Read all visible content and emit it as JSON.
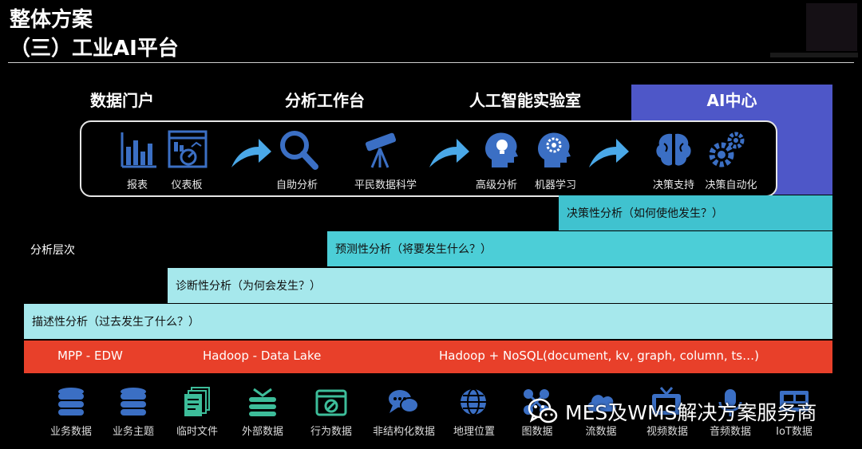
{
  "header": {
    "title_line1": "整体方案",
    "title_line2": "（三）工业AI平台"
  },
  "categories": [
    {
      "label": "数据门户"
    },
    {
      "label": "分析工作台"
    },
    {
      "label": "人工智能实验室"
    },
    {
      "label": "AI中心"
    }
  ],
  "tools": [
    {
      "label": "报表",
      "icon": "bar-chart-icon"
    },
    {
      "label": "仪表板",
      "icon": "dashboard-icon"
    },
    {
      "label": "自助分析",
      "icon": "magnifier-icon"
    },
    {
      "label": "平民数据科学",
      "icon": "telescope-icon"
    },
    {
      "label": "高级分析",
      "icon": "lightbulb-head-icon"
    },
    {
      "label": "机器学习",
      "icon": "gear-head-icon"
    },
    {
      "label": "决策支持",
      "icon": "brain-icon"
    },
    {
      "label": "决策自动化",
      "icon": "gears-icon"
    }
  ],
  "analysis": {
    "layer_label": "分析层次",
    "levels": [
      {
        "label": "决策性分析（如何使他发生？）"
      },
      {
        "label": "预测性分析（将要发生什么？）"
      },
      {
        "label": "诊断性分析（为何会发生？）"
      },
      {
        "label": "描述性分析（过去发生了什么？）"
      }
    ]
  },
  "storage": [
    {
      "label": "MPP - EDW"
    },
    {
      "label": "Hadoop - Data Lake"
    },
    {
      "label": "Hadoop + NoSQL(document, kv, graph, column, ts…)"
    }
  ],
  "sources": [
    {
      "label": "业务数据",
      "icon": "database-icon"
    },
    {
      "label": "业务主题",
      "icon": "database-icon"
    },
    {
      "label": "临时文件",
      "icon": "files-icon"
    },
    {
      "label": "外部数据",
      "icon": "external-data-icon"
    },
    {
      "label": "行为数据",
      "icon": "behavior-icon"
    },
    {
      "label": "非结构化数据",
      "icon": "chat-bubbles-icon"
    },
    {
      "label": "地理位置",
      "icon": "globe-icon"
    },
    {
      "label": "图数据",
      "icon": "graph-icon"
    },
    {
      "label": "流数据",
      "icon": "cloud-icon"
    },
    {
      "label": "视频数据",
      "icon": "tv-icon"
    },
    {
      "label": "音频数据",
      "icon": "audio-icon"
    },
    {
      "label": "IoT数据",
      "icon": "iot-icon"
    }
  ],
  "watermark": {
    "text": "MES及WMS解决方案服务商"
  },
  "colors": {
    "ai_block": "#4e57c8",
    "decision_band": "#40c2cf",
    "predictive_band": "#4cced7",
    "light_band": "#a6e8ec",
    "storage_band": "#e8402a",
    "icon_blue": "#3b6fc4",
    "icon_green": "#3dbd9a"
  }
}
